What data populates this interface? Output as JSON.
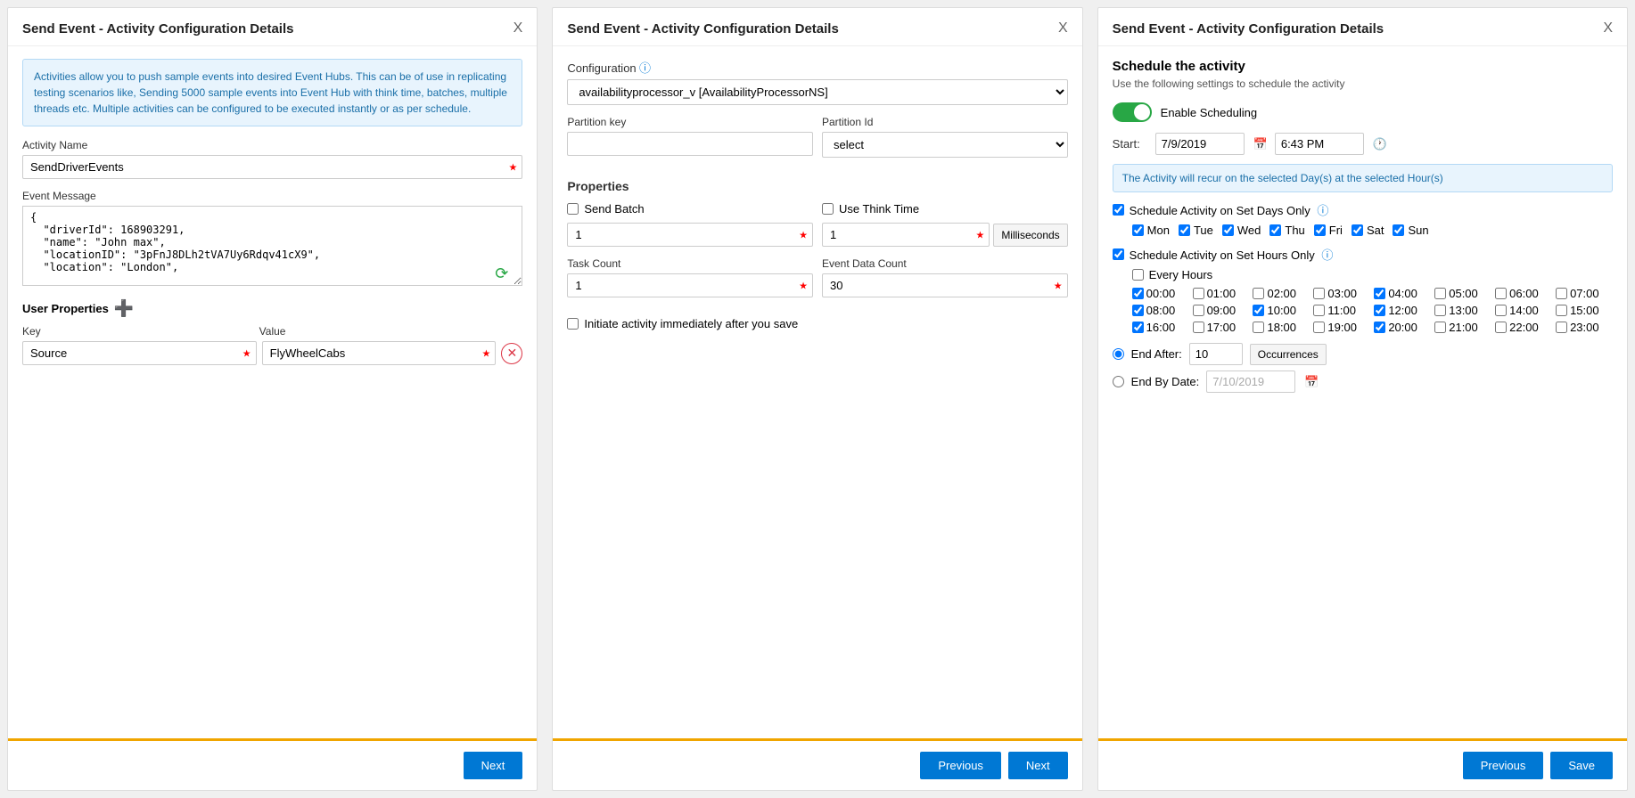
{
  "panel1": {
    "title": "Send Event - Activity Configuration Details",
    "close": "X",
    "info_text": "Activities allow you to push sample events into desired Event Hubs. This can be of use in replicating testing scenarios like, Sending 5000 sample events into Event Hub with think time, batches, multiple threads etc. Multiple activities can be configured to be executed instantly or as per schedule.",
    "activity_name_label": "Activity Name",
    "activity_name_value": "SendDriverEvents",
    "event_message_label": "Event Message",
    "event_message_value": "{\n  \"driverId\": 168903291,\n  \"name\": \"John max\",\n  \"locationID\": \"3pFnJ8DLh2tVA7Uy6Rdqv41cX9\",\n  \"location\": \"London\",",
    "user_properties_title": "User Properties",
    "key_label": "Key",
    "value_label": "Value",
    "key_value": "Source",
    "value_value": "FlyWheelCabs",
    "next_label": "Next"
  },
  "panel2": {
    "title": "Send Event - Activity Configuration Details",
    "close": "X",
    "config_label": "Configuration",
    "config_value": "availabilityprocessor_v [AvailabilityProcessorNS]",
    "partition_key_label": "Partition key",
    "partition_key_value": "",
    "partition_id_label": "Partition Id",
    "partition_id_value": "select",
    "properties_title": "Properties",
    "send_batch_label": "Send Batch",
    "send_batch_checked": false,
    "send_batch_value": "1",
    "use_think_time_label": "Use Think Time",
    "use_think_time_checked": false,
    "use_think_time_value": "1",
    "milliseconds_label": "Milliseconds",
    "task_count_label": "Task Count",
    "task_count_value": "1",
    "event_data_count_label": "Event Data Count",
    "event_data_count_value": "30",
    "initiate_label": "Initiate activity immediately after you save",
    "initiate_checked": false,
    "previous_label": "Previous",
    "next_label": "Next"
  },
  "panel3": {
    "title": "Send Event - Activity Configuration Details",
    "close": "X",
    "schedule_title": "Schedule the activity",
    "schedule_sub": "Use the following settings to schedule the activity",
    "enable_scheduling_label": "Enable Scheduling",
    "start_label": "Start:",
    "start_date": "7/9/2019",
    "start_time": "6:43 PM",
    "recur_info": "The Activity will recur on the selected Day(s) at the selected Hour(s)",
    "schedule_days_label": "Schedule Activity on Set Days Only",
    "schedule_days_checked": true,
    "days": [
      {
        "label": "Mon",
        "checked": true
      },
      {
        "label": "Tue",
        "checked": true
      },
      {
        "label": "Wed",
        "checked": true
      },
      {
        "label": "Thu",
        "checked": true
      },
      {
        "label": "Fri",
        "checked": true
      },
      {
        "label": "Sat",
        "checked": true
      },
      {
        "label": "Sun",
        "checked": true
      }
    ],
    "schedule_hours_label": "Schedule Activity on Set Hours Only",
    "schedule_hours_checked": true,
    "every_hours_label": "Every Hours",
    "every_hours_checked": false,
    "hours": [
      {
        "label": "00:00",
        "checked": true
      },
      {
        "label": "01:00",
        "checked": false
      },
      {
        "label": "02:00",
        "checked": false
      },
      {
        "label": "03:00",
        "checked": false
      },
      {
        "label": "04:00",
        "checked": true
      },
      {
        "label": "05:00",
        "checked": false
      },
      {
        "label": "06:00",
        "checked": false
      },
      {
        "label": "07:00",
        "checked": false
      },
      {
        "label": "08:00",
        "checked": true
      },
      {
        "label": "09:00",
        "checked": false
      },
      {
        "label": "10:00",
        "checked": true
      },
      {
        "label": "11:00",
        "checked": false
      },
      {
        "label": "12:00",
        "checked": true
      },
      {
        "label": "13:00",
        "checked": false
      },
      {
        "label": "14:00",
        "checked": false
      },
      {
        "label": "15:00",
        "checked": false
      },
      {
        "label": "16:00",
        "checked": true
      },
      {
        "label": "17:00",
        "checked": false
      },
      {
        "label": "18:00",
        "checked": false
      },
      {
        "label": "19:00",
        "checked": false
      },
      {
        "label": "20:00",
        "checked": true
      },
      {
        "label": "21:00",
        "checked": false
      },
      {
        "label": "22:00",
        "checked": false
      },
      {
        "label": "23:00",
        "checked": false
      }
    ],
    "end_after_label": "End After:",
    "end_after_selected": true,
    "end_after_value": "10",
    "occurrences_label": "Occurrences",
    "end_by_date_label": "End By Date:",
    "end_by_date_selected": false,
    "end_by_date_value": "7/10/2019",
    "previous_label": "Previous",
    "save_label": "Save"
  }
}
